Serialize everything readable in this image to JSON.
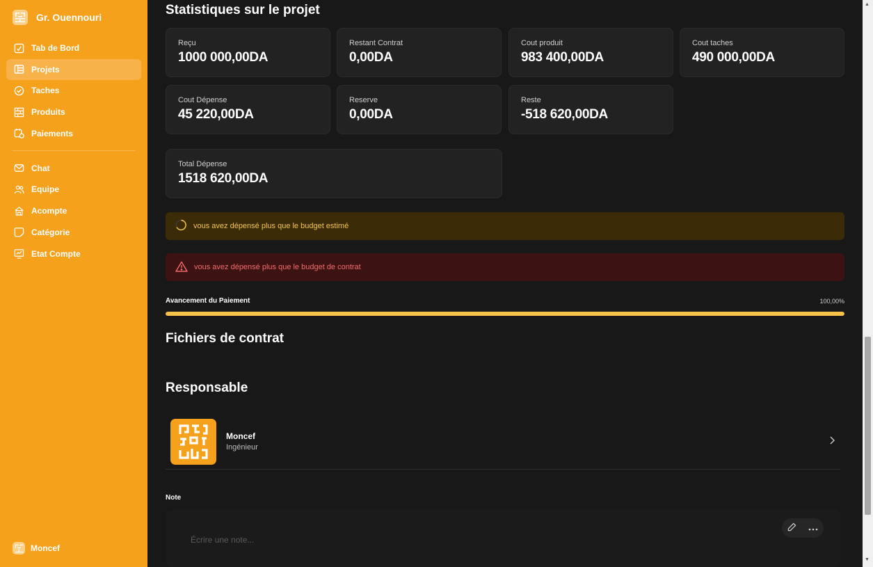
{
  "brand": {
    "name": "Gr. Ouennouri",
    "logo_icon": "qr-logo-icon"
  },
  "sidebar": {
    "items": [
      {
        "label": "Tab de Bord",
        "icon": "dashboard-icon",
        "active": false
      },
      {
        "label": "Projets",
        "icon": "projects-icon",
        "active": true
      },
      {
        "label": "Taches",
        "icon": "check-circle-icon",
        "active": false
      },
      {
        "label": "Produits",
        "icon": "products-icon",
        "active": false
      },
      {
        "label": "Paiements",
        "icon": "payments-icon",
        "active": false
      }
    ],
    "items2": [
      {
        "label": "Chat",
        "icon": "mail-icon"
      },
      {
        "label": "Equipe",
        "icon": "team-icon"
      },
      {
        "label": "Acompte",
        "icon": "deposit-icon"
      },
      {
        "label": "Catégorie",
        "icon": "category-icon"
      },
      {
        "label": "Etat Compte",
        "icon": "account-state-icon"
      }
    ],
    "user": "Moncef"
  },
  "stats": {
    "title": "Statistiques sur le projet",
    "cards": [
      {
        "label": "Reçu",
        "value": "1000 000,00DA"
      },
      {
        "label": "Restant Contrat",
        "value": "0,00DA"
      },
      {
        "label": "Cout produit",
        "value": "983 400,00DA"
      },
      {
        "label": "Cout taches",
        "value": "490 000,00DA"
      },
      {
        "label": "Cout Dépense",
        "value": "45 220,00DA"
      },
      {
        "label": "Reserve",
        "value": "0,00DA"
      },
      {
        "label": "Reste",
        "value": "-518 620,00DA"
      },
      {
        "label": "Total Dépense",
        "value": "1518 620,00DA"
      }
    ]
  },
  "alerts": {
    "warning": "vous avez dépensé plus que le budget estimé",
    "danger": "vous avez dépensé plus que le budget de contrat"
  },
  "payment_progress": {
    "label": "Avancement du Paiement",
    "value_text": "100,00%",
    "fraction": 1.0
  },
  "contract_files": {
    "title": "Fichiers de contrat"
  },
  "responsable": {
    "title": "Responsable",
    "name": "Moncef",
    "role": "Ingénieur"
  },
  "note": {
    "label": "Note",
    "placeholder": "Écrire une note..."
  },
  "colors": {
    "sidebar": "#f6a11b",
    "background": "#181818",
    "card": "#222222",
    "progress": "#f8c14a",
    "warning_text": "#f5c451",
    "danger_text": "#f26d6d"
  }
}
